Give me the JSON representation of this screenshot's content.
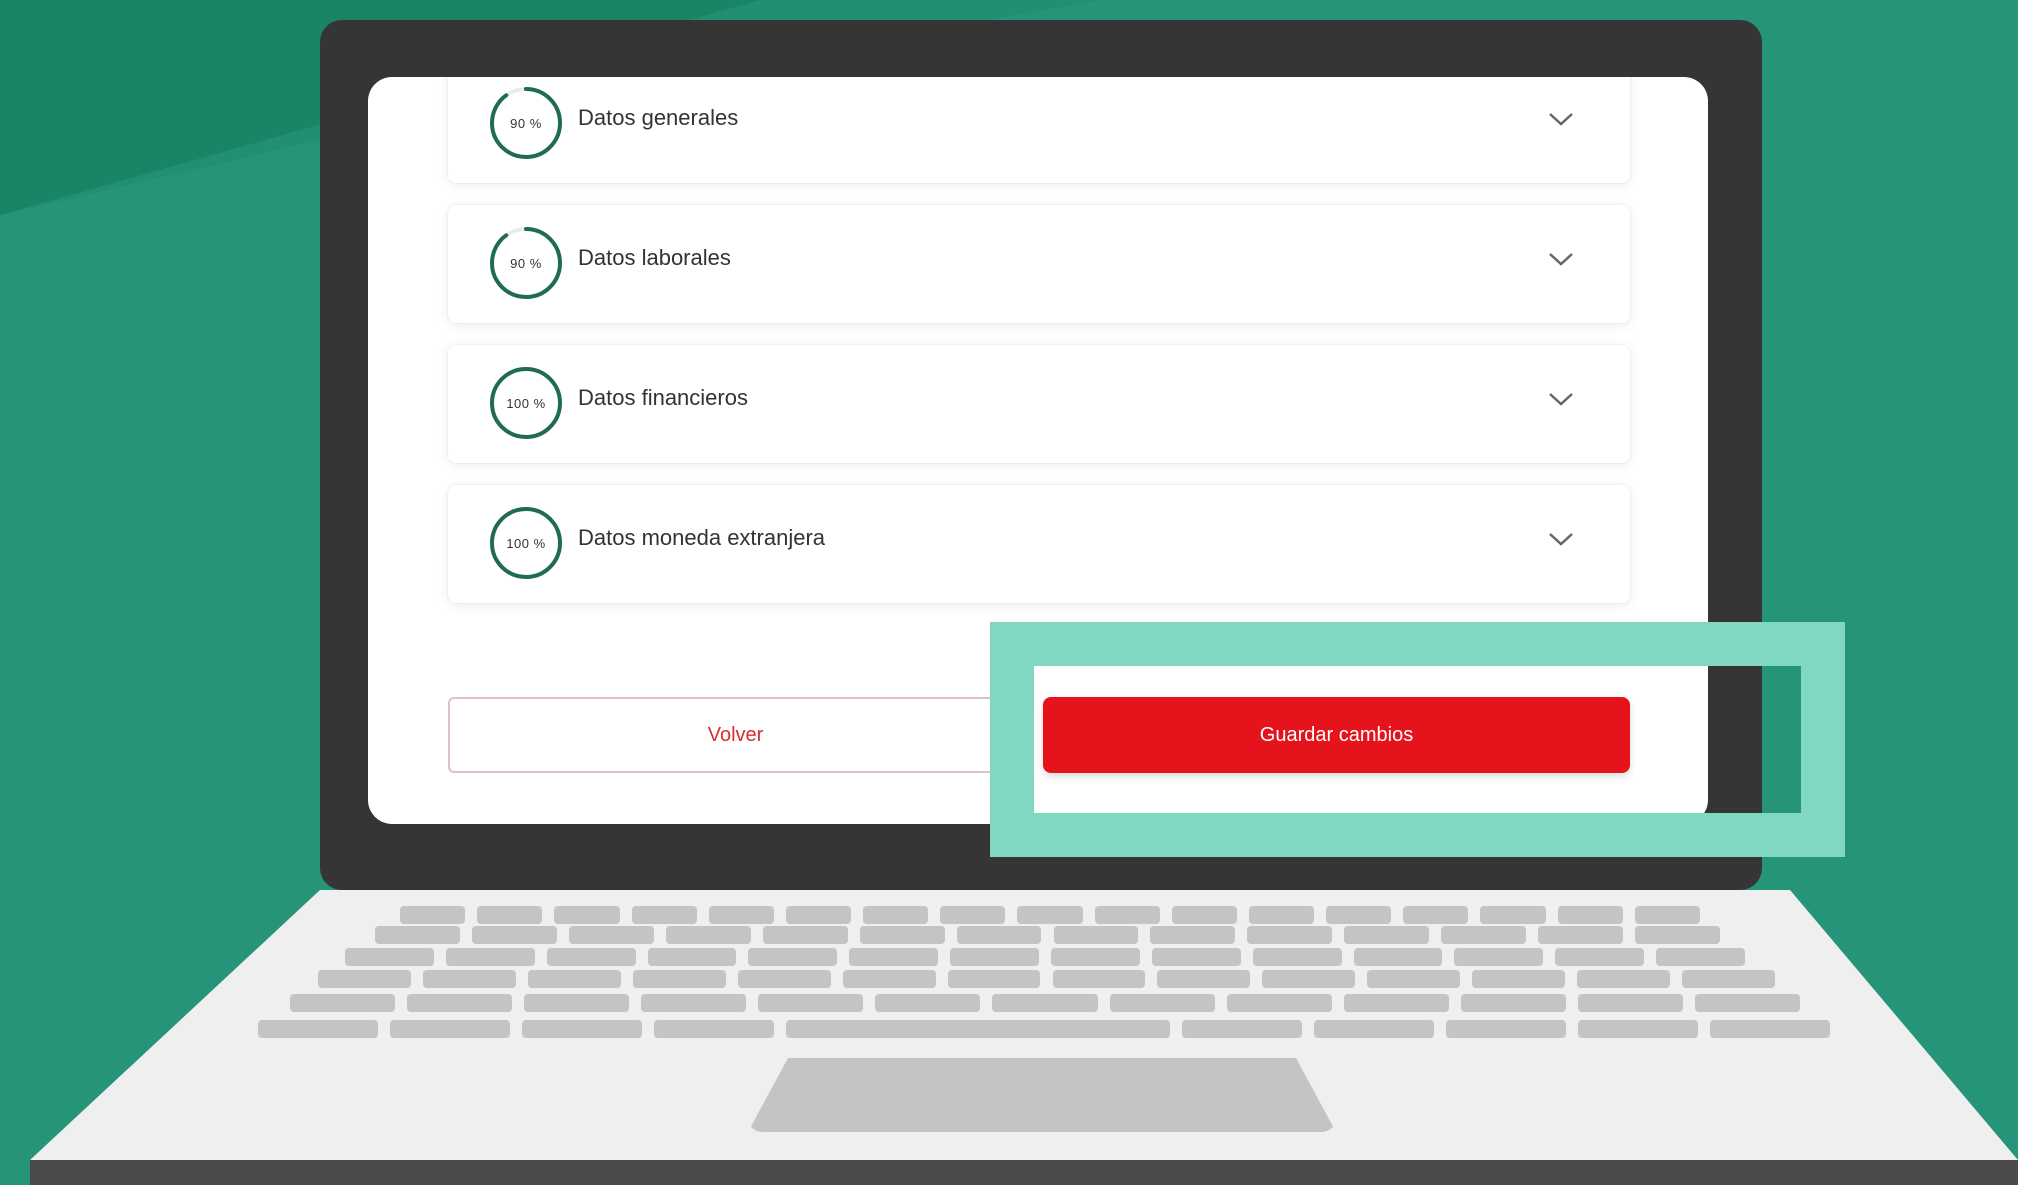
{
  "colors": {
    "background": "#259478",
    "highlight": "#80d8c2",
    "primary_button": "#e4131c",
    "progress_ring": "#1f6b58"
  },
  "sections": [
    {
      "percent_label": "90 %",
      "progress": 0.9,
      "title": "Datos generales",
      "icon": "chevron-down-icon"
    },
    {
      "percent_label": "90 %",
      "progress": 0.9,
      "title": "Datos laborales",
      "icon": "chevron-down-icon"
    },
    {
      "percent_label": "100 %",
      "progress": 1.0,
      "title": "Datos financieros",
      "icon": "chevron-down-icon"
    },
    {
      "percent_label": "100 %",
      "progress": 1.0,
      "title": "Datos moneda extranjera",
      "icon": "chevron-down-icon"
    }
  ],
  "actions": {
    "back_label": "Volver",
    "save_label": "Guardar cambios"
  }
}
